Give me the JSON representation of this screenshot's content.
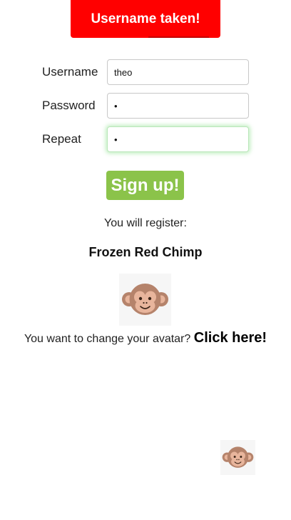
{
  "toast": {
    "message": "Username taken!",
    "color": "#ff0000"
  },
  "form": {
    "username": {
      "label": "Username",
      "value": "theo"
    },
    "password": {
      "label": "Password",
      "value": "•"
    },
    "repeat": {
      "label": "Repeat",
      "value": "•"
    }
  },
  "signup": {
    "label": "Sign up!",
    "color": "#8bc34a"
  },
  "register": {
    "intro": "You will register:",
    "name": "Frozen Red Chimp",
    "avatar_icon": "monkey-face-icon"
  },
  "avatar_change": {
    "prompt": "You want to change your avatar?",
    "link": "Click here!"
  }
}
